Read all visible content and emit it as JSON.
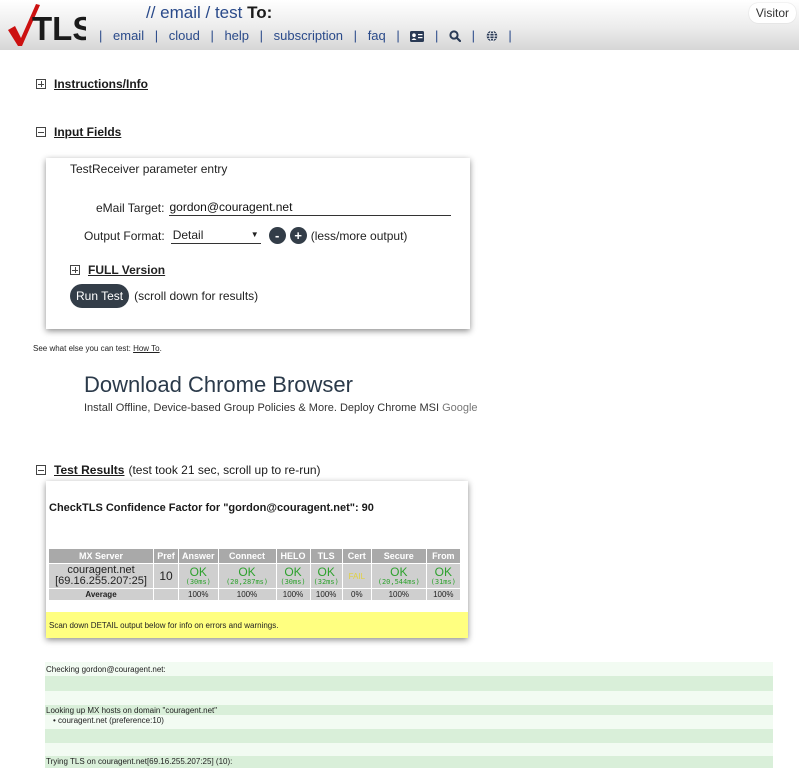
{
  "header": {
    "brand": "TLS",
    "breadcrumb": "// email / test",
    "breadcrumb_bold": "To:",
    "nav": [
      {
        "label": "email"
      },
      {
        "label": "cloud"
      },
      {
        "label": "help"
      },
      {
        "label": "subscription"
      },
      {
        "label": "faq"
      }
    ],
    "user_badge": "Visitor"
  },
  "sections": {
    "instructions": "Instructions/Info",
    "input_fields": "Input Fields",
    "test_results": "Test Results",
    "test_results_note": "(test took 21 sec, scroll up to re-run)"
  },
  "form": {
    "panel_title": "TestReceiver parameter entry",
    "email_label": "eMail Target:",
    "email_value": "gordon@couragent.net",
    "format_label": "Output Format:",
    "format_value": "Detail",
    "less_symbol": "-",
    "more_symbol": "+",
    "format_hint": "(less/more output)",
    "full_version": "FULL Version",
    "run_button": "Run Test",
    "run_hint": "(scroll down for results)"
  },
  "see_what": {
    "prefix": "See what else you can test:",
    "link": "How To",
    "suffix": "."
  },
  "ad": {
    "headline": "Download Chrome Browser",
    "subtext": "Install Offline, Device-based Group Policies & More. Deploy Chrome MSI",
    "brand": "Google"
  },
  "results": {
    "title": "CheckTLS Confidence Factor for \"gordon@couragent.net\": 90",
    "columns": [
      "MX Server",
      "Pref",
      "Answer",
      "Connect",
      "HELO",
      "TLS",
      "Cert",
      "Secure",
      "From"
    ],
    "server_name": "couragent.net",
    "server_ip": "[69.16.255.207:25]",
    "pref": "10",
    "answer": {
      "status": "OK",
      "time": "(30ms)"
    },
    "connect": {
      "status": "OK",
      "time": "(20,287ms)"
    },
    "helo": {
      "status": "OK",
      "time": "(30ms)"
    },
    "tls": {
      "status": "OK",
      "time": "(32ms)"
    },
    "cert": {
      "status": "FAIL"
    },
    "secure": {
      "status": "OK",
      "time": "(20,544ms)"
    },
    "from": {
      "status": "OK",
      "time": "(31ms)"
    },
    "average_label": "Average",
    "averages": [
      "100%",
      "100%",
      "100%",
      "100%",
      "0%",
      "100%",
      "100%"
    ],
    "note": "Scan down DETAIL output below for info on errors and warnings."
  },
  "log": {
    "line1": "Checking gordon@couragent.net:",
    "line2": "Looking up MX hosts on domain \"couragent.net\"",
    "line3": "couragent.net (preference:10)",
    "line4": "Trying TLS on couragent.net[69.16.255.207:25] (10):"
  },
  "colors": {
    "brand_red": "#cc1111",
    "ok_green": "#2ea12e",
    "fail_yellow": "#e0d040",
    "dark_button": "#333d48",
    "note_yellow": "#ffff80"
  }
}
